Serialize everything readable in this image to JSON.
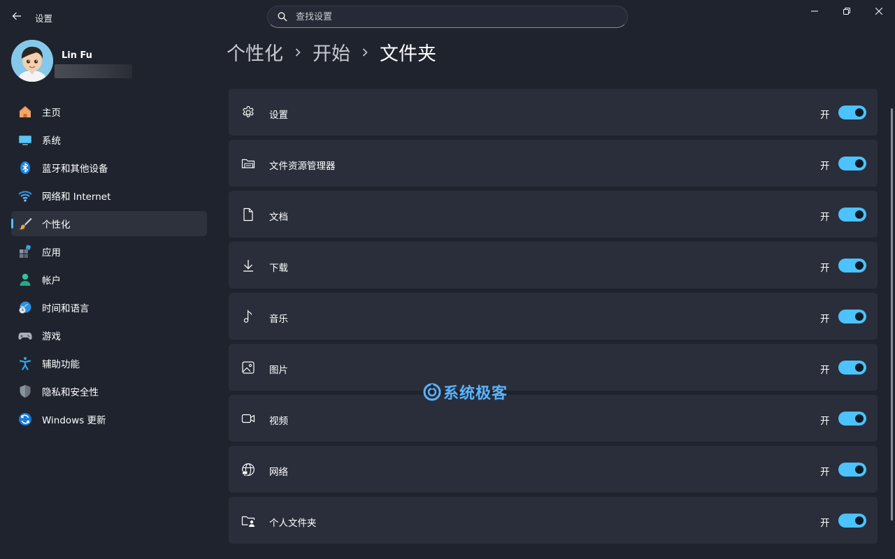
{
  "window": {
    "title": "设置",
    "search_placeholder": "查找设置"
  },
  "user": {
    "name": "Lin Fu"
  },
  "sidebar": {
    "items": [
      {
        "label": "主页",
        "icon": "home-icon"
      },
      {
        "label": "系统",
        "icon": "display-icon"
      },
      {
        "label": "蓝牙和其他设备",
        "icon": "bluetooth-icon"
      },
      {
        "label": "网络和 Internet",
        "icon": "wifi-icon"
      },
      {
        "label": "个性化",
        "icon": "paintbrush-icon",
        "active": true
      },
      {
        "label": "应用",
        "icon": "apps-icon"
      },
      {
        "label": "帐户",
        "icon": "person-icon"
      },
      {
        "label": "时间和语言",
        "icon": "globe-clock-icon"
      },
      {
        "label": "游戏",
        "icon": "gamepad-icon"
      },
      {
        "label": "辅助功能",
        "icon": "accessibility-icon"
      },
      {
        "label": "隐私和安全性",
        "icon": "shield-icon"
      },
      {
        "label": "Windows 更新",
        "icon": "update-icon"
      }
    ]
  },
  "breadcrumb": [
    "个性化",
    "开始",
    "文件夹"
  ],
  "folders": [
    {
      "label": "设置",
      "icon": "gear-icon",
      "state": "开",
      "on": true
    },
    {
      "label": "文件资源管理器",
      "icon": "folder-open-icon",
      "state": "开",
      "on": true
    },
    {
      "label": "文档",
      "icon": "document-icon",
      "state": "开",
      "on": true
    },
    {
      "label": "下载",
      "icon": "download-icon",
      "state": "开",
      "on": true
    },
    {
      "label": "音乐",
      "icon": "music-note-icon",
      "state": "开",
      "on": true
    },
    {
      "label": "图片",
      "icon": "image-icon",
      "state": "开",
      "on": true
    },
    {
      "label": "视频",
      "icon": "video-icon",
      "state": "开",
      "on": true
    },
    {
      "label": "网络",
      "icon": "network-globe-icon",
      "state": "开",
      "on": true
    },
    {
      "label": "个人文件夹",
      "icon": "personal-folder-icon",
      "state": "开",
      "on": true
    }
  ],
  "watermark": "系统极客",
  "colors": {
    "accent": "#4cc2ff",
    "background": "#1f232e",
    "card": "#2a2e3a",
    "nav_active": "#2e323d"
  }
}
